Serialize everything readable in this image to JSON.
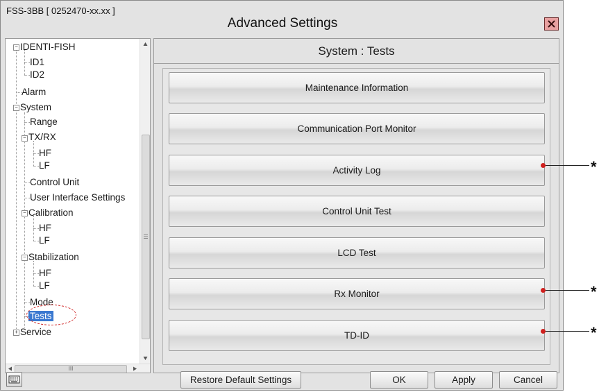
{
  "window": {
    "device_label": "FSS-3BB [ 0252470-xx.xx ]",
    "title": "Advanced Settings",
    "close_icon": "close-icon"
  },
  "tree": {
    "items": [
      {
        "label": "IDENTI-FISH"
      },
      {
        "label": "ID1"
      },
      {
        "label": "ID2"
      },
      {
        "label": "Alarm"
      },
      {
        "label": "System"
      },
      {
        "label": "Range"
      },
      {
        "label": "TX/RX"
      },
      {
        "label": "HF"
      },
      {
        "label": "LF"
      },
      {
        "label": "Control Unit"
      },
      {
        "label": "User Interface Settings"
      },
      {
        "label": "Calibration"
      },
      {
        "label": "HF"
      },
      {
        "label": "LF"
      },
      {
        "label": "Stabilization"
      },
      {
        "label": "HF"
      },
      {
        "label": "LF"
      },
      {
        "label": "Mode"
      },
      {
        "label": "Tests"
      },
      {
        "label": "Service"
      }
    ],
    "selected": "Tests",
    "hscroll_thumb": "III"
  },
  "panel": {
    "title": "System : Tests",
    "buttons": [
      {
        "label": "Maintenance Information"
      },
      {
        "label": "Communication Port Monitor"
      },
      {
        "label": "Activity Log"
      },
      {
        "label": "Control Unit Test"
      },
      {
        "label": "LCD Test"
      },
      {
        "label": "Rx Monitor"
      },
      {
        "label": "TD-ID"
      }
    ]
  },
  "footer": {
    "restore_label": "Restore Default Settings",
    "ok_label": "OK",
    "apply_label": "Apply",
    "cancel_label": "Cancel",
    "keyboard_icon": "keyboard-icon"
  },
  "annotations": {
    "marker": "*"
  }
}
